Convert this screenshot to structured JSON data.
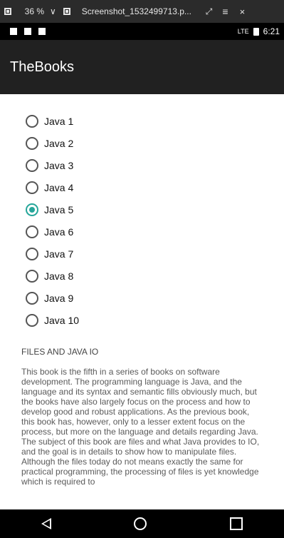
{
  "viewer": {
    "zoom": "36 %",
    "filename": "Screenshot_1532499713.p...",
    "expand_icon": "⤢",
    "menu_icon": "≡",
    "close_icon": "×",
    "chevron": "∨"
  },
  "status_bar": {
    "signal": "LTE",
    "time": "6:21"
  },
  "app": {
    "title": "TheBooks"
  },
  "radio_options": {
    "items": [
      {
        "label": "Java 1",
        "checked": false
      },
      {
        "label": "Java 2",
        "checked": false
      },
      {
        "label": "Java 3",
        "checked": false
      },
      {
        "label": "Java 4",
        "checked": false
      },
      {
        "label": "Java 5",
        "checked": true
      },
      {
        "label": "Java 6",
        "checked": false
      },
      {
        "label": "Java 7",
        "checked": false
      },
      {
        "label": "Java 8",
        "checked": false
      },
      {
        "label": "Java 9",
        "checked": false
      },
      {
        "label": "Java 10",
        "checked": false
      }
    ]
  },
  "book": {
    "heading": "FILES AND JAVA IO",
    "description": "This book is the fifth in a series of books on software development. The programming language is Java, and the language and its syntax and semantic fills obviously much, but the books have also largely focus on the process and how to develop good and robust applications. As the previous book, this book has, however, only to a lesser extent focus on the process, but more on the language and details regarding Java. The subject of this book are files and what Java provides to IO, and the goal is in details to show how to manipulate files. Although the files today do not means exactly the same for practical programming, the processing of files is yet knowledge which is required to"
  },
  "colors": {
    "accent": "#26a69a",
    "app_bar": "#212121"
  }
}
